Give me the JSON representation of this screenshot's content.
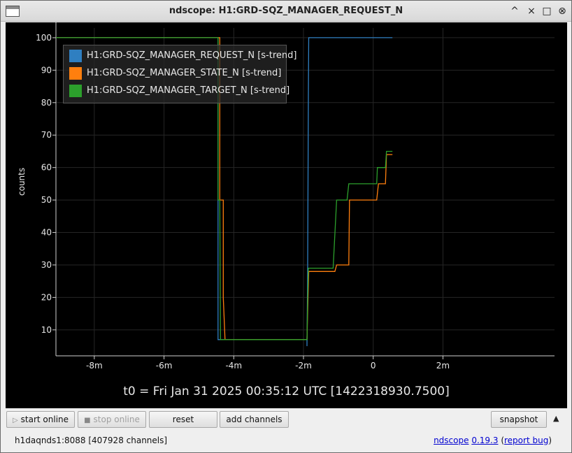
{
  "window": {
    "title": "ndscope: H1:GRD-SQZ_MANAGER_REQUEST_N",
    "controls": [
      "^",
      "×",
      "□",
      "⊗"
    ]
  },
  "plot": {
    "ylabel": "counts",
    "t0_label": "t0 = Fri Jan 31 2025 00:35:12 UTC [1422318930.7500]",
    "xticks": [
      "-8m",
      "-6m",
      "-4m",
      "-2m",
      "0",
      "2m"
    ],
    "yticks": [
      "10",
      "20",
      "30",
      "40",
      "50",
      "60",
      "70",
      "80",
      "90",
      "100"
    ]
  },
  "legend": [
    {
      "label": "H1:GRD-SQZ_MANAGER_REQUEST_N [s-trend]",
      "color": "#2f7fc1"
    },
    {
      "label": "H1:GRD-SQZ_MANAGER_STATE_N [s-trend]",
      "color": "#ff7f0e"
    },
    {
      "label": "H1:GRD-SQZ_MANAGER_TARGET_N [s-trend]",
      "color": "#2ca02c"
    }
  ],
  "chart_data": {
    "type": "line",
    "xlabel": "",
    "ylabel": "counts",
    "x_unit": "minutes relative to t0",
    "xlim": [
      -9.1,
      5.2
    ],
    "ylim": [
      2,
      103
    ],
    "grid": true,
    "legend_placement": "top-left",
    "series": [
      {
        "name": "H1:GRD-SQZ_MANAGER_REQUEST_N [s-trend]",
        "color": "#2f7fc1",
        "points": [
          [
            -9.1,
            100
          ],
          [
            -4.45,
            100
          ],
          [
            -4.45,
            7
          ],
          [
            -1.9,
            7
          ],
          [
            -1.9,
            5
          ],
          [
            -1.88,
            30
          ],
          [
            -1.86,
            82
          ],
          [
            -1.85,
            100
          ],
          [
            0.55,
            100
          ]
        ]
      },
      {
        "name": "H1:GRD-SQZ_MANAGER_STATE_N [s-trend]",
        "color": "#ff7f0e",
        "points": [
          [
            -9.1,
            100
          ],
          [
            -4.4,
            100
          ],
          [
            -4.4,
            50
          ],
          [
            -4.3,
            50
          ],
          [
            -4.3,
            20
          ],
          [
            -4.25,
            7
          ],
          [
            -1.9,
            7
          ],
          [
            -1.87,
            20
          ],
          [
            -1.85,
            28
          ],
          [
            -1.1,
            28
          ],
          [
            -1.05,
            30
          ],
          [
            -0.7,
            30
          ],
          [
            -0.68,
            50
          ],
          [
            0.1,
            50
          ],
          [
            0.15,
            55
          ],
          [
            0.35,
            55
          ],
          [
            0.38,
            64
          ],
          [
            0.55,
            64
          ]
        ]
      },
      {
        "name": "H1:GRD-SQZ_MANAGER_TARGET_N [s-trend]",
        "color": "#2ca02c",
        "points": [
          [
            -9.1,
            100
          ],
          [
            -4.45,
            100
          ],
          [
            -4.45,
            50
          ],
          [
            -4.4,
            50
          ],
          [
            -4.38,
            7
          ],
          [
            -1.9,
            7
          ],
          [
            -1.88,
            20
          ],
          [
            -1.86,
            29
          ],
          [
            -1.15,
            29
          ],
          [
            -1.05,
            50
          ],
          [
            -0.75,
            50
          ],
          [
            -0.7,
            55
          ],
          [
            0.1,
            55
          ],
          [
            0.12,
            60
          ],
          [
            0.35,
            60
          ],
          [
            0.38,
            65
          ],
          [
            0.55,
            65
          ]
        ]
      }
    ]
  },
  "toolbar": {
    "start_online": "start online",
    "stop_online": "stop online",
    "reset": "reset",
    "add_channels": "add channels",
    "snapshot": "snapshot",
    "collapse_glyph": "▲"
  },
  "status": {
    "server": "h1daqnds1:8088  [407928 channels]",
    "app_name": "ndscope",
    "version": "0.19.3",
    "open_paren": "(",
    "report_bug": "report bug",
    "close_paren": ")"
  }
}
